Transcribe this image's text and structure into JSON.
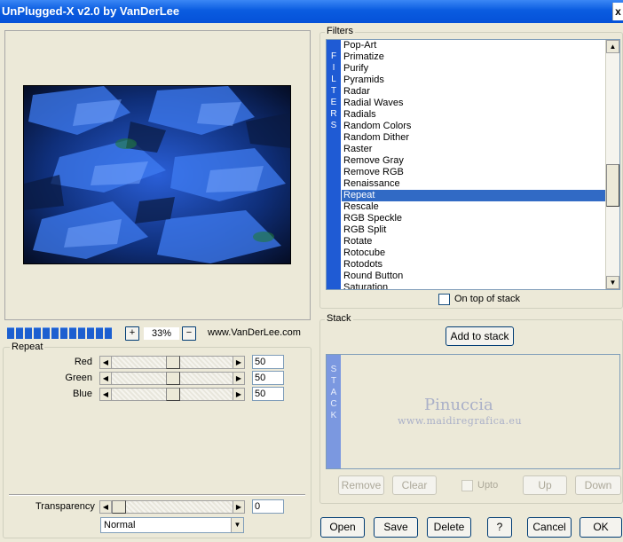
{
  "window": {
    "title": "UnPlugged-X v2.0 by VanDerLee",
    "close_glyph": "x"
  },
  "preview": {
    "zoom_value": "33%",
    "zoom_in": "+",
    "zoom_out": "−",
    "website": "www.VanDerLee.com",
    "progress_fraction": 1.0
  },
  "params": {
    "group_label": "Repeat",
    "sliders": [
      {
        "label": "Red",
        "value": "50",
        "fraction": 0.5
      },
      {
        "label": "Green",
        "value": "50",
        "fraction": 0.5
      },
      {
        "label": "Blue",
        "value": "50",
        "fraction": 0.5
      }
    ],
    "transparency": {
      "label": "Transparency",
      "value": "0",
      "fraction": 0.0
    },
    "blend_mode": "Normal"
  },
  "filters": {
    "group_label": "Filters",
    "side_label": "FILTERS",
    "items": [
      "Pop-Art",
      "Primatize",
      "Purify",
      "Pyramids",
      "Radar",
      "Radial Waves",
      "Radials",
      "Random Colors",
      "Random Dither",
      "Raster",
      "Remove Gray",
      "Remove RGB",
      "Renaissance",
      "Repeat",
      "Rescale",
      "RGB Speckle",
      "RGB Split",
      "Rotate",
      "Rotocube",
      "Rotodots",
      "Round Button",
      "Saturation"
    ],
    "selected": "Repeat",
    "on_top_label": "On top of stack"
  },
  "stack": {
    "group_label": "Stack",
    "side_label": "STACK",
    "add_label": "Add to stack",
    "watermark": "Pinuccia",
    "watermark_url": "www.maidiregrafica.eu",
    "remove_label": "Remove",
    "clear_label": "Clear",
    "upto_label": "Upto",
    "up_label": "Up",
    "down_label": "Down"
  },
  "footer": {
    "open": "Open",
    "save": "Save",
    "delete": "Delete",
    "help": "?",
    "cancel": "Cancel",
    "ok": "OK"
  },
  "icons": {
    "left": "◀",
    "right": "▶",
    "up": "▲",
    "down": "▼"
  },
  "colors": {
    "accent": "#1f5bd4",
    "selection": "#316ac5",
    "face": "#ece9d8"
  }
}
